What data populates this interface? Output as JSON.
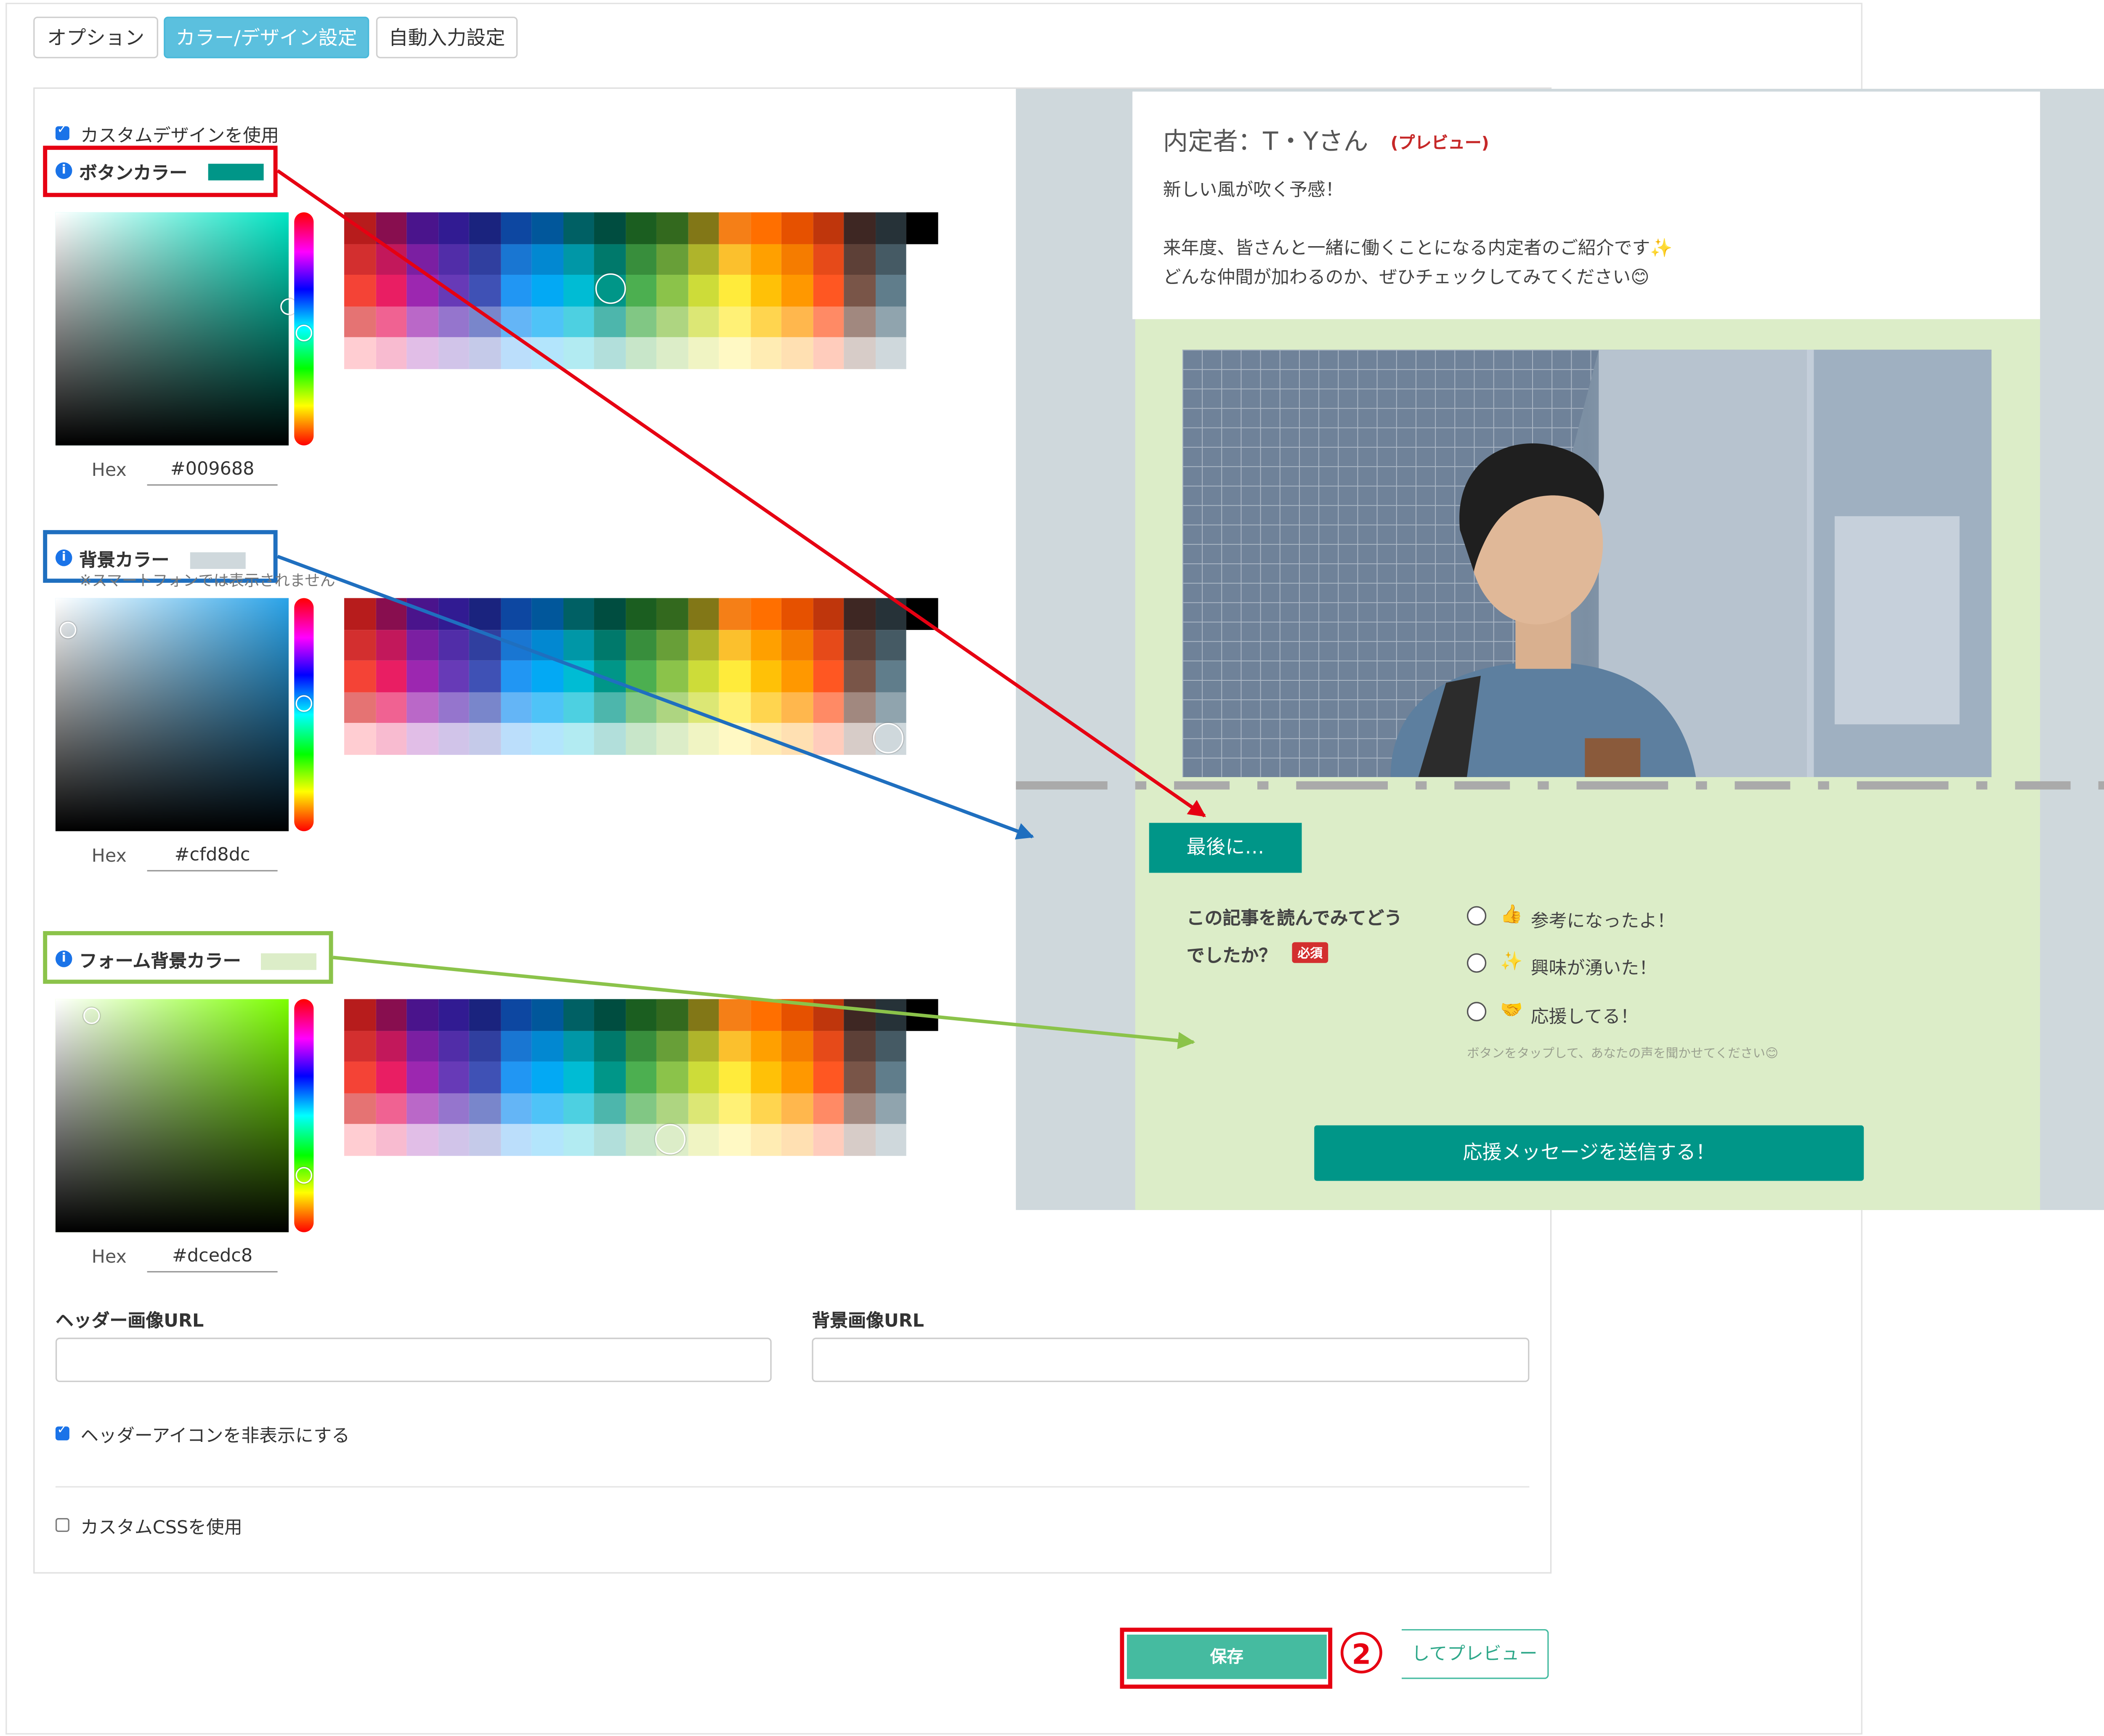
{
  "tabs": [
    {
      "label": "オプション"
    },
    {
      "label": "カラー/デザイン設定"
    },
    {
      "label": "自動入力設定"
    }
  ],
  "custom_design": {
    "label": "カスタムデザインを使用",
    "checked": true
  },
  "button_color": {
    "label": "ボタンカラー",
    "hex_label": "Hex",
    "hex": "#009688",
    "highlight": "#e60012",
    "hue": "#00e5c4"
  },
  "background_color": {
    "label": "背景カラー",
    "note": "※スマートフォンでは表示されません",
    "hex_label": "Hex",
    "hex": "#cfd8dc",
    "highlight": "#1f6fbf",
    "hue": "#2aa3e8"
  },
  "form_background_color": {
    "label": "フォーム背景カラー",
    "hex_label": "Hex",
    "hex": "#dcedc8",
    "highlight": "#8bc34a",
    "hue": "#7cff00"
  },
  "fields": {
    "header_image_url": {
      "label": "ヘッダー画像URL",
      "value": ""
    },
    "background_image_url": {
      "label": "背景画像URL",
      "value": ""
    }
  },
  "hide_header_icon": {
    "label": "ヘッダーアイコンを非表示にする",
    "checked": true
  },
  "custom_css": {
    "label": "カスタムCSSを使用",
    "checked": false
  },
  "preview": {
    "title": "内定者：T・Yさん",
    "title_tag": "(プレビュー)",
    "line1": "新しい風が吹く予感！",
    "line2": "来年度、皆さんと一緒に働くことになる内定者のご紹介です✨",
    "line3": "どんな仲間が加わるのか、ぜひチェックしてみてください😊",
    "section_button": "最後に…",
    "question_line1": "この記事を読んでみてどう",
    "question_line2": "でしたか？",
    "required": "必須",
    "options": [
      {
        "icon": "👍",
        "label": "参考になったよ！"
      },
      {
        "icon": "✨",
        "label": "興味が湧いた！"
      },
      {
        "icon": "🤝",
        "label": "応援してる！"
      }
    ],
    "hint": "ボタンをタップして、あなたの声を聞かせてください😊",
    "submit": "応援メッセージを送信する！"
  },
  "save_button": "保存",
  "preview_button": "してプレビュー",
  "step_marker": "2",
  "palette": [
    [
      "#b71c1c",
      "#880e4f",
      "#4a148c",
      "#311b92",
      "#1a237e",
      "#0d47a1",
      "#01579b",
      "#006064",
      "#004d40",
      "#1b5e20",
      "#33691e",
      "#827717",
      "#f57f17",
      "#ff6f00",
      "#e65100",
      "#bf360c",
      "#3e2723",
      "#263238",
      "#000000"
    ],
    [
      "#d32f2f",
      "#c2185b",
      "#7b1fa2",
      "#512da8",
      "#303f9f",
      "#1976d2",
      "#0288d1",
      "#0097a7",
      "#00796b",
      "#388e3c",
      "#689f38",
      "#afb42b",
      "#fbc02d",
      "#ffa000",
      "#f57c00",
      "#e64a19",
      "#5d4037",
      "#455a64",
      "#ffffff"
    ],
    [
      "#f44336",
      "#e91e63",
      "#9c27b0",
      "#673ab7",
      "#3f51b5",
      "#2196f3",
      "#03a9f4",
      "#00bcd4",
      "#009688",
      "#4caf50",
      "#8bc34a",
      "#cddc39",
      "#ffeb3b",
      "#ffc107",
      "#ff9800",
      "#ff5722",
      "#795548",
      "#607d8b",
      ""
    ],
    [
      "#e57373",
      "#f06292",
      "#ba68c8",
      "#9575cd",
      "#7986cb",
      "#64b5f6",
      "#4fc3f7",
      "#4dd0e1",
      "#4db6ac",
      "#81c784",
      "#aed581",
      "#dce775",
      "#fff176",
      "#ffd54f",
      "#ffb74d",
      "#ff8a65",
      "#a1887f",
      "#90a4ae",
      ""
    ],
    [
      "#ffcdd2",
      "#f8bbd0",
      "#e1bee7",
      "#d1c4e9",
      "#c5cae9",
      "#bbdefb",
      "#b3e5fc",
      "#b2ebf2",
      "#b2dfdb",
      "#c8e6c9",
      "#dcedc8",
      "#f0f4c3",
      "#fff9c4",
      "#ffecb3",
      "#ffe0b2",
      "#ffccbc",
      "#d7ccc8",
      "#cfd8dc",
      ""
    ]
  ]
}
